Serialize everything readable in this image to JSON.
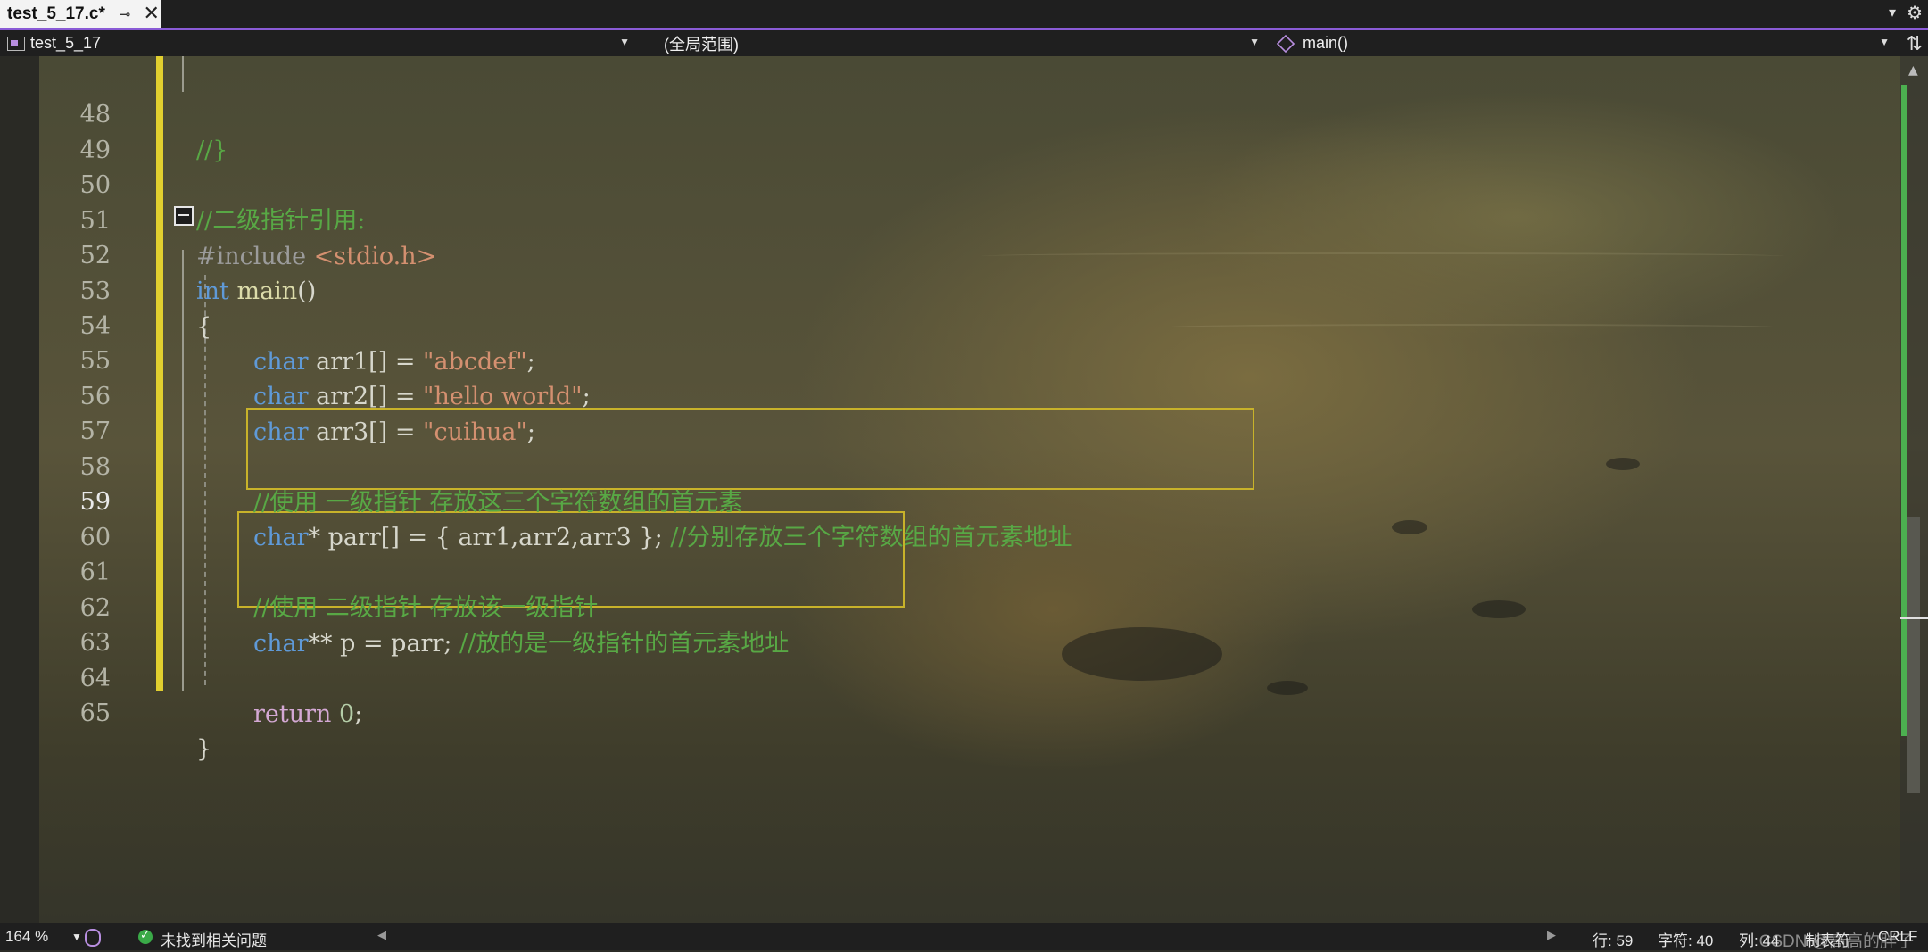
{
  "tab": {
    "title": "test_5_17.c*",
    "pin_glyph": "⊸",
    "close_glyph": "✕"
  },
  "navbar": {
    "project": "test_5_17",
    "scope": "(全局范围)",
    "function": "main()"
  },
  "lines": [
    {
      "num": "48"
    },
    {
      "num": "49"
    },
    {
      "num": "50"
    },
    {
      "num": "51"
    },
    {
      "num": "52"
    },
    {
      "num": "53"
    },
    {
      "num": "54"
    },
    {
      "num": "55"
    },
    {
      "num": "56"
    },
    {
      "num": "57"
    },
    {
      "num": "58"
    },
    {
      "num": "59"
    },
    {
      "num": "60"
    },
    {
      "num": "61"
    },
    {
      "num": "62"
    },
    {
      "num": "63"
    },
    {
      "num": "64"
    },
    {
      "num": "65"
    }
  ],
  "code": {
    "l48": "//}",
    "l50": "//二级指针引用:",
    "l51_pp": "#include ",
    "l51_inc": "<stdio.h>",
    "l52_kw": "int",
    "l52_fn": " main",
    "l52_rest": "()",
    "l53": "{",
    "l54_kw": "char",
    "l54_rest": " arr1[] = ",
    "l54_str": "\"abcdef\"",
    "l54_end": ";",
    "l55_kw": "char",
    "l55_rest": " arr2[] = ",
    "l55_str": "\"hello world\"",
    "l55_end": ";",
    "l56_kw": "char",
    "l56_rest": " arr3[] = ",
    "l56_str": "\"cuihua\"",
    "l56_end": ";",
    "l58": "//使用 一级指针 存放这三个字符数组的首元素",
    "l59_kw": "char",
    "l59_rest": "* parr[] = { arr1,arr2,arr3 }; ",
    "l59_cm": "//分别存放三个字符数组的首元素地址",
    "l61": "//使用 二级指针 存放该一级指针",
    "l62_kw": "char",
    "l62_rest": "** p = parr; ",
    "l62_cm": "//放的是一级指针的首元素地址",
    "l64_kw": "return",
    "l64_num": " 0",
    "l64_end": ";",
    "l65": "}"
  },
  "status": {
    "zoom": "164 %",
    "issues": "未找到相关问题",
    "line": "行: 59",
    "char": "字符: 40",
    "col": "列: 44",
    "tabs": "制表符",
    "eol": "CRLF",
    "watermark": "CSDN @高高的胖子"
  }
}
